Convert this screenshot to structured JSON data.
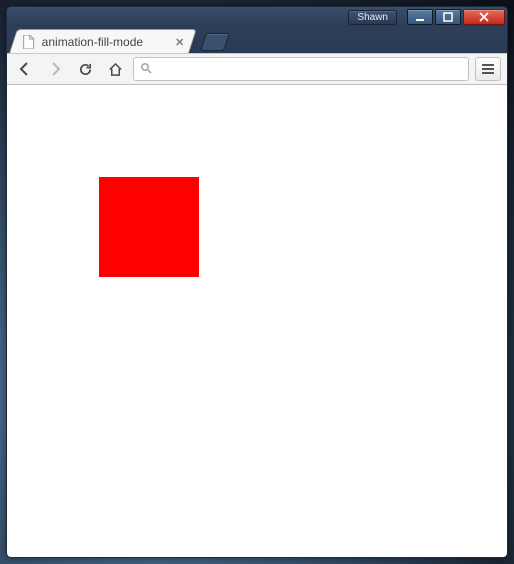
{
  "window": {
    "user_label": "Shawn"
  },
  "tab": {
    "title": "animation-fill-mode"
  },
  "toolbar": {
    "address_value": "",
    "address_placeholder": ""
  },
  "content": {
    "square_color": "#ff0000"
  }
}
